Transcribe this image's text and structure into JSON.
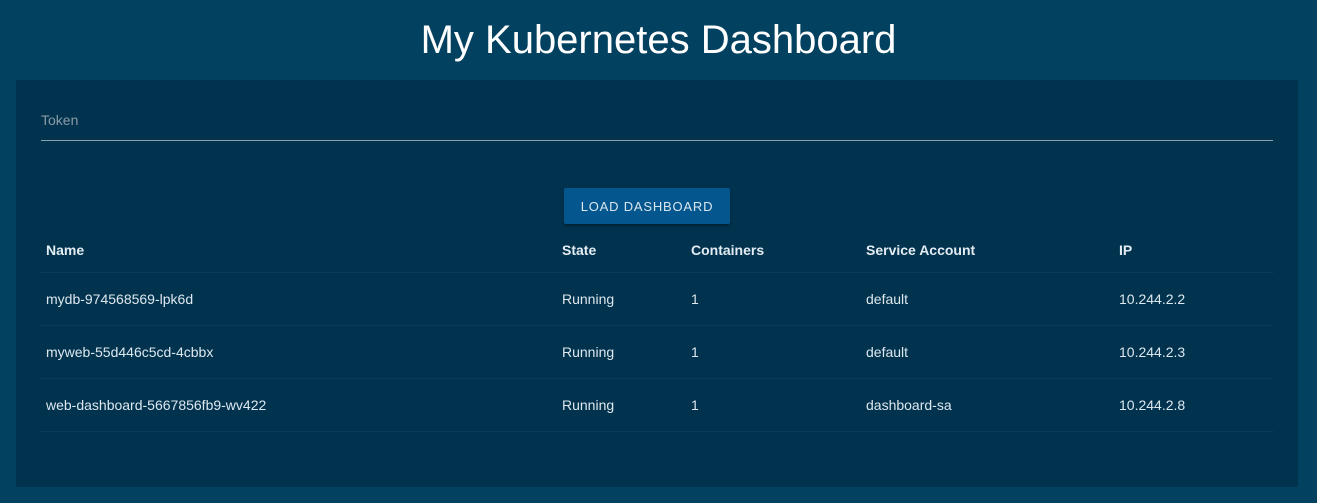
{
  "header": {
    "title": "My Kubernetes Dashboard"
  },
  "token": {
    "placeholder": "Token",
    "value": ""
  },
  "actions": {
    "load_label": "LOAD DASHBOARD"
  },
  "table": {
    "columns": [
      "Name",
      "State",
      "Containers",
      "Service Account",
      "IP"
    ],
    "rows": [
      {
        "name": "mydb-974568569-lpk6d",
        "state": "Running",
        "containers": "1",
        "service_account": "default",
        "ip": "10.244.2.2"
      },
      {
        "name": "myweb-55d446c5cd-4cbbx",
        "state": "Running",
        "containers": "1",
        "service_account": "default",
        "ip": "10.244.2.3"
      },
      {
        "name": "web-dashboard-5667856fb9-wv422",
        "state": "Running",
        "containers": "1",
        "service_account": "dashboard-sa",
        "ip": "10.244.2.8"
      }
    ]
  },
  "colors": {
    "page_background": "#02415f",
    "panel_background": "#01334f",
    "button_background": "#04568e"
  }
}
